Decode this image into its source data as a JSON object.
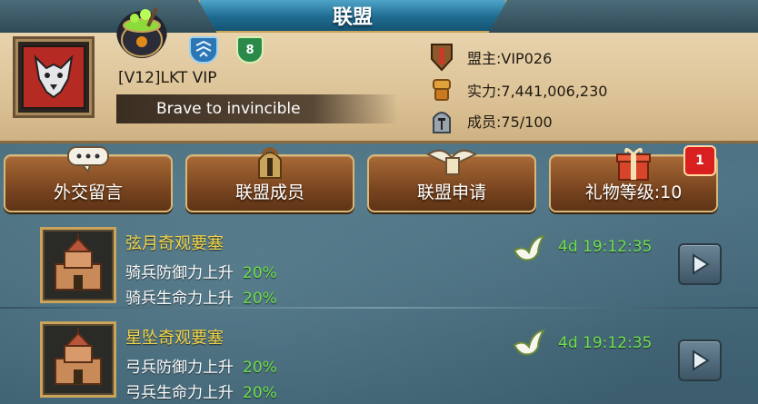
{
  "window": {
    "title": "联盟"
  },
  "guild": {
    "rank_badge": "8",
    "name": "[V12]LKT VIP",
    "slogan": "Brave to invincible",
    "leader": "盟主:VIP026",
    "power": "实力:7,441,006,230",
    "members": "成员:75/100"
  },
  "tabs": [
    {
      "label": "外交留言",
      "icon": "chat-bubble-icon"
    },
    {
      "label": "联盟成员",
      "icon": "spartan-helmet-icon"
    },
    {
      "label": "联盟申请",
      "icon": "winged-scroll-icon"
    },
    {
      "label": "礼物等级:10",
      "icon": "gift-box-icon",
      "notification_count": "1"
    }
  ],
  "wonders": [
    {
      "name": "弦月奇观要塞",
      "buffs": [
        {
          "label": "骑兵防御力上升",
          "value": "20%"
        },
        {
          "label": "骑兵生命力上升",
          "value": "20%"
        }
      ],
      "timer": "4d 19:12:35"
    },
    {
      "name": "星坠奇观要塞",
      "buffs": [
        {
          "label": "弓兵防御力上升",
          "value": "20%"
        },
        {
          "label": "弓兵生命力上升",
          "value": "20%"
        }
      ],
      "timer": "4d 19:12:35"
    }
  ],
  "colors": {
    "title_plate": "#1f6b90",
    "parchment": "#dcc296",
    "tab_brown": "#7a4520",
    "wonder_title": "#f2d448",
    "buff_green": "#6ee04a",
    "badge_red": "#d91f1f"
  }
}
